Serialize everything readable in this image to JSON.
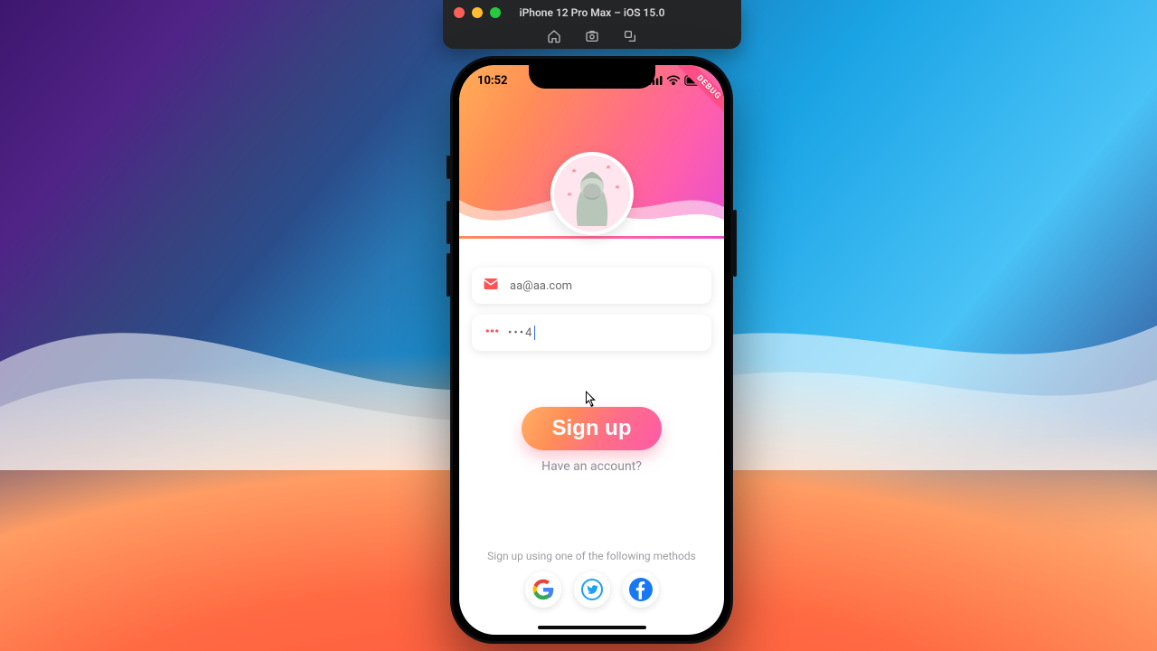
{
  "simulator": {
    "title": "iPhone 12 Pro Max – iOS 15.0"
  },
  "status": {
    "time": "10:52"
  },
  "debug_banner": "DEBUG",
  "form": {
    "email_value": "aa@aa.com",
    "password_display": "•••4"
  },
  "buttons": {
    "signup_label": "Sign up",
    "have_account_label": "Have an account?"
  },
  "social": {
    "caption": "Sign up using one of the following methods"
  },
  "colors": {
    "gradient_start": "#ffae55",
    "gradient_end": "#e64fd1",
    "accent": "#ff6f86"
  }
}
